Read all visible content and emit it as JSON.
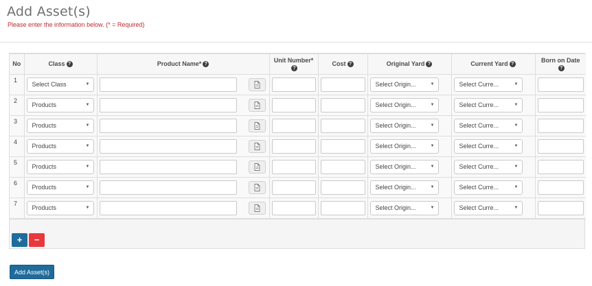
{
  "header": {
    "title": "Add Asset(s)",
    "subtitle": "Please enter the information below. (* = Required)"
  },
  "table": {
    "columns": {
      "no": "No",
      "class": "Class",
      "product_name": "Product Name*",
      "unit_number": "Unit Number*",
      "cost": "Cost",
      "original_yard": "Original Yard",
      "current_yard": "Current Yard",
      "born_on_date": "Born on Date"
    },
    "help_glyph": "?",
    "rows": [
      {
        "no": "1",
        "class": "Select Class",
        "original_yard": "Select Origin...",
        "current_yard": "Select Curre..."
      },
      {
        "no": "2",
        "class": "Products",
        "original_yard": "Select Origin...",
        "current_yard": "Select Curre..."
      },
      {
        "no": "3",
        "class": "Products",
        "original_yard": "Select Origin...",
        "current_yard": "Select Curre..."
      },
      {
        "no": "4",
        "class": "Products",
        "original_yard": "Select Origin...",
        "current_yard": "Select Curre..."
      },
      {
        "no": "5",
        "class": "Products",
        "original_yard": "Select Origin...",
        "current_yard": "Select Curre..."
      },
      {
        "no": "6",
        "class": "Products",
        "original_yard": "Select Origin...",
        "current_yard": "Select Curre..."
      },
      {
        "no": "7",
        "class": "Products",
        "original_yard": "Select Origin...",
        "current_yard": "Select Curre..."
      }
    ],
    "dropdown_caret": "▼"
  },
  "actions": {
    "add_row": "+",
    "remove_row": "−",
    "submit": "Add Asset(s)"
  },
  "colors": {
    "primary_blue": "#1f6b9c",
    "danger_red": "#e8383d",
    "subtitle_red": "#c0282d"
  }
}
